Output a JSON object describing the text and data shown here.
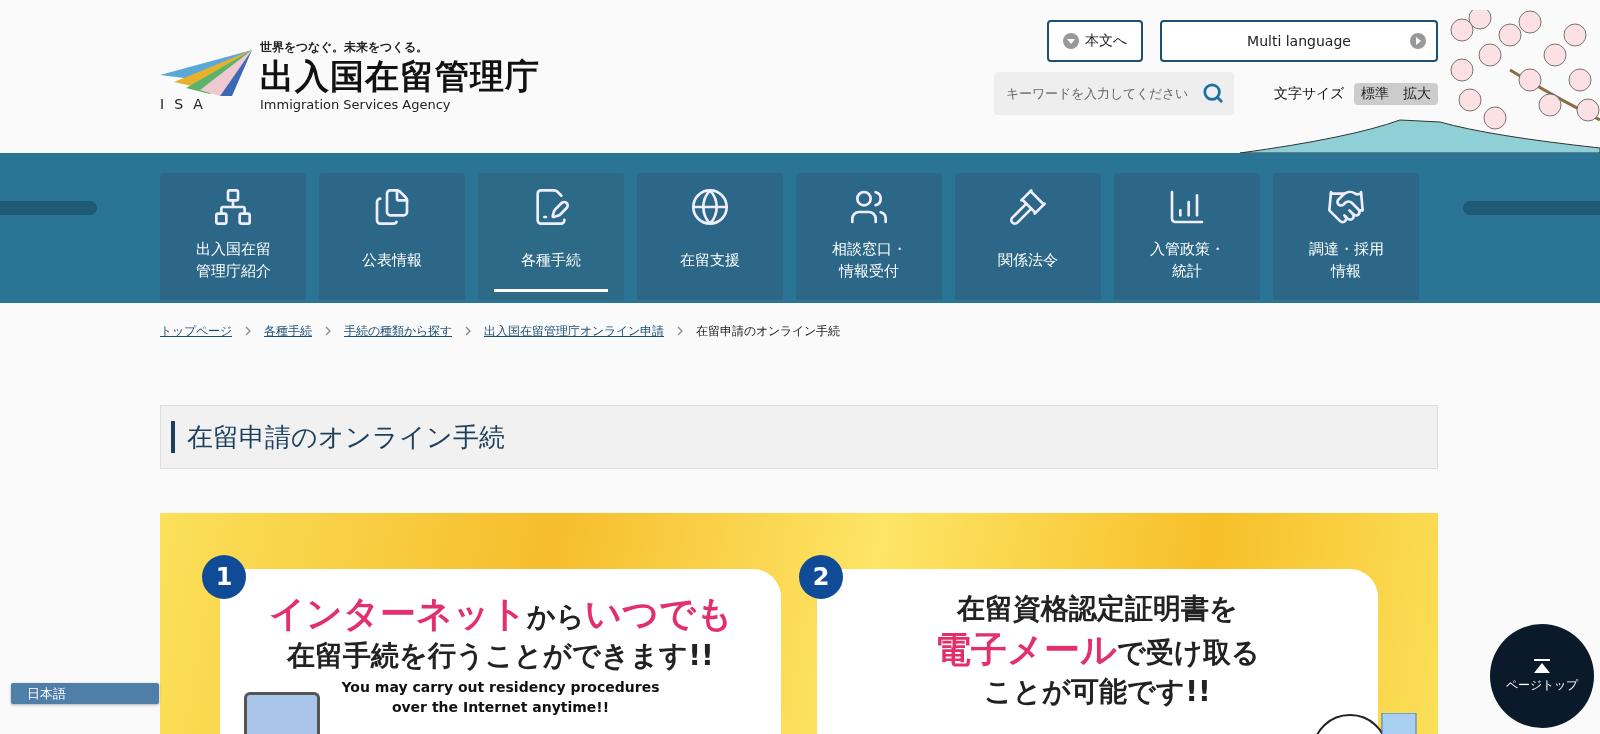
{
  "header": {
    "logo": {
      "mark": "ISA",
      "tagline": "世界をつなぐ。未来をつくる。",
      "name": "出入国在留管理庁",
      "name_en": "Immigration Services Agency"
    },
    "skip_link": "本文へ",
    "language_button": "Multi language",
    "search": {
      "placeholder": "キーワードを入力してください"
    },
    "font_size": {
      "label": "文字サイズ",
      "options": [
        "標準",
        "拡大"
      ]
    }
  },
  "nav": [
    {
      "lines": [
        "出入国在留",
        "管理庁紹介"
      ],
      "selected": false
    },
    {
      "lines": [
        "公表情報"
      ],
      "selected": false
    },
    {
      "lines": [
        "各種手続"
      ],
      "selected": true
    },
    {
      "lines": [
        "在留支援"
      ],
      "selected": false
    },
    {
      "lines": [
        "相談窓口・",
        "情報受付"
      ],
      "selected": false
    },
    {
      "lines": [
        "関係法令"
      ],
      "selected": false
    },
    {
      "lines": [
        "入管政策・",
        "統計"
      ],
      "selected": false
    },
    {
      "lines": [
        "調達・採用",
        "情報"
      ],
      "selected": false
    }
  ],
  "breadcrumb": [
    {
      "label": "トップページ",
      "kind": "link"
    },
    {
      "label": "各種手続",
      "kind": "link"
    },
    {
      "label": "手続の種類から探す",
      "kind": "link"
    },
    {
      "label": "出入国在留管理庁オンライン申請",
      "kind": "link"
    },
    {
      "label": "在留申請のオンライン手続",
      "kind": "current"
    }
  ],
  "page_title": "在留申請のオンライン手続",
  "banner": {
    "cards": [
      {
        "number": "1",
        "lines": [
          [
            {
              "text": "インターネット",
              "highlight": true
            },
            {
              "text": "から",
              "highlight": false
            },
            {
              "text": "いつでも",
              "highlight": true
            }
          ],
          [
            {
              "text": "在留手続を行うことができます!!",
              "highlight": false
            }
          ]
        ],
        "english": [
          "You may carry out residency procedures",
          "over the Internet anytime!!"
        ]
      },
      {
        "number": "2",
        "lines": [
          [
            {
              "text": "在留資格認定証明書を",
              "highlight": false
            }
          ],
          [
            {
              "text": "電子メール",
              "highlight": true
            },
            {
              "text": "で受け取る",
              "highlight": false
            }
          ],
          [
            {
              "text": "ことが可能です!!",
              "highlight": false
            }
          ]
        ]
      }
    ]
  },
  "language_tab": "日本語",
  "page_top": "ページトップ"
}
